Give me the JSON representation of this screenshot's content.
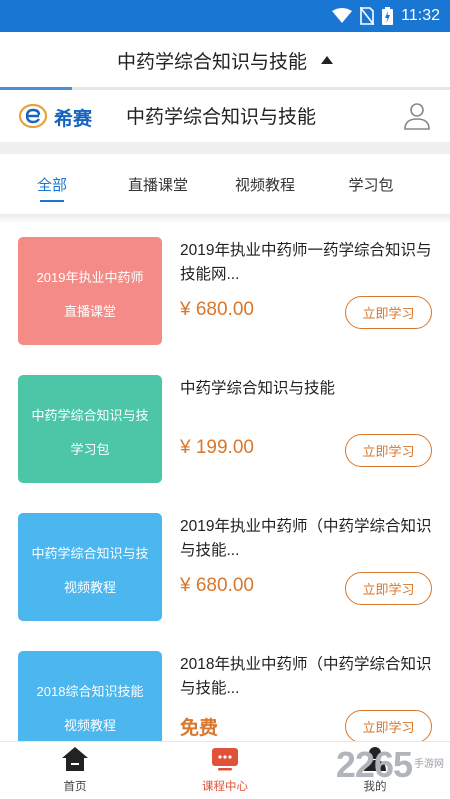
{
  "status_bar": {
    "time": "11:32"
  },
  "title_bar": {
    "title": "中药学综合知识与技能"
  },
  "brand": {
    "name": "希赛",
    "page_title": "中药学综合知识与技能"
  },
  "tabs": [
    {
      "label": "全部",
      "active": true
    },
    {
      "label": "直播课堂",
      "active": false
    },
    {
      "label": "视频教程",
      "active": false
    },
    {
      "label": "学习包",
      "active": false
    }
  ],
  "courses": [
    {
      "thumb_line1": "2019年执业中药师",
      "thumb_line2": "直播课堂",
      "thumb_color": "#f58b87",
      "title": "2019年执业中药师一药学综合知识与技能网...",
      "price": "¥ 680.00",
      "button": "立即学习"
    },
    {
      "thumb_line1": "中药学综合知识与技",
      "thumb_line2": "学习包",
      "thumb_color": "#4dc6a8",
      "title": "中药学综合知识与技能",
      "price": "¥ 199.00",
      "button": "立即学习"
    },
    {
      "thumb_line1": "中药学综合知识与技",
      "thumb_line2": "视频教程",
      "thumb_color": "#4cb6ef",
      "title": "2019年执业中药师（中药学综合知识与技能...",
      "price": "¥ 680.00",
      "button": "立即学习"
    },
    {
      "thumb_line1": "2018综合知识技能",
      "thumb_line2": "视频教程",
      "thumb_color": "#4cb6ef",
      "title": "2018年执业中药师（中药学综合知识与技能...",
      "price": "免费",
      "button": "立即学习"
    }
  ],
  "bottom_nav": [
    {
      "label": "首页",
      "icon": "home-icon",
      "active": false
    },
    {
      "label": "课程中心",
      "icon": "course-center-icon",
      "active": true
    },
    {
      "label": "我的",
      "icon": "profile-icon",
      "active": false
    }
  ],
  "watermark": {
    "number": "2265",
    "text1": "手游网",
    "text2": ""
  },
  "colors": {
    "status_bar": "#1976d2",
    "accent": "#1976d2",
    "price": "#d9772b",
    "nav_active": "#e0533a"
  }
}
